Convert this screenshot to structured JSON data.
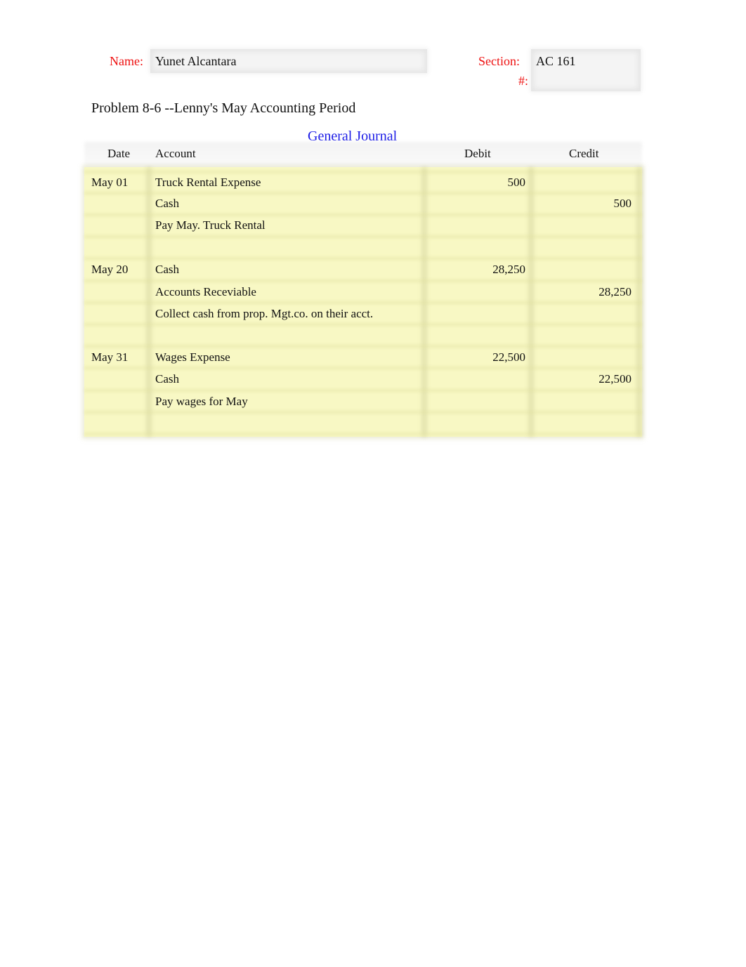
{
  "header": {
    "name_label": "Name:",
    "name_value": "Yunet Alcantara",
    "section_label": "Section:",
    "section_value": "AC 161",
    "number_label": "#:",
    "number_value": ""
  },
  "problem_title": "Problem 8-6 --Lenny's May Accounting Period",
  "journal": {
    "title": "General Journal",
    "columns": [
      "Date",
      "Account",
      "Debit",
      "Credit"
    ],
    "rows": [
      {
        "date": "May 01",
        "account": "Truck Rental Expense",
        "debit": "500",
        "credit": ""
      },
      {
        "date": "",
        "account": "Cash",
        "debit": "",
        "credit": "500"
      },
      {
        "date": "",
        "account": "Pay May. Truck Rental",
        "debit": "",
        "credit": ""
      },
      {
        "date": "May 20",
        "account": "Cash",
        "debit": "28,250",
        "credit": ""
      },
      {
        "date": "",
        "account": "Accounts Receviable",
        "debit": "",
        "credit": "28,250"
      },
      {
        "date": "",
        "account": "Collect cash from prop. Mgt.co. on their acct.",
        "debit": "",
        "credit": ""
      },
      {
        "date": "May 31",
        "account": "Wages Expense",
        "debit": "22,500",
        "credit": ""
      },
      {
        "date": "",
        "account": "Cash",
        "debit": "",
        "credit": "22,500"
      },
      {
        "date": "",
        "account": "Pay wages for May",
        "debit": "",
        "credit": ""
      }
    ]
  }
}
